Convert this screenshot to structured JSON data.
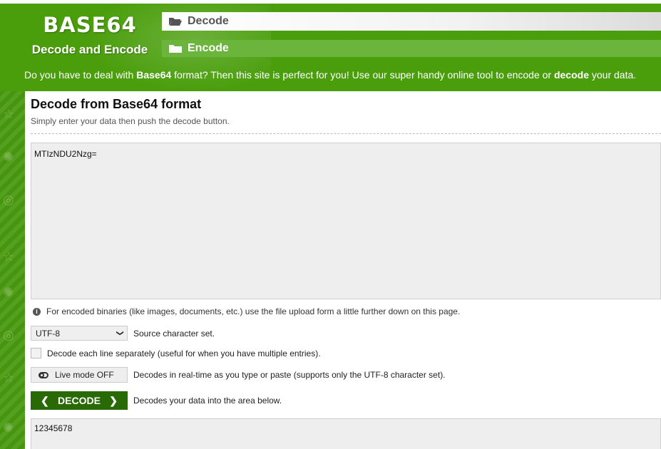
{
  "header": {
    "logo_title": "BASE64",
    "logo_subtitle": "Decode and Encode",
    "nav": [
      {
        "label": "Decode",
        "icon": "folder-open-icon"
      },
      {
        "label": "Encode",
        "icon": "folder-icon"
      }
    ],
    "intro_prefix": "Do you have to deal with ",
    "intro_bold1": "Base64",
    "intro_mid": " format? Then this site is perfect for you! Use our super handy online tool to encode or ",
    "intro_bold2": "decode",
    "intro_suffix": " your data."
  },
  "main": {
    "title": "Decode from Base64 format",
    "subtitle": "Simply enter your data then push the decode button.",
    "input_value": "MTIzNDU2Nzg=",
    "info_text": "For encoded binaries (like images, documents, etc.) use the file upload form a little further down on this page.",
    "charset": {
      "selected": "UTF-8",
      "label": "Source character set."
    },
    "each_line": {
      "label": "Decode each line separately (useful for when you have multiple entries).",
      "checked": false
    },
    "live_mode": {
      "button_label": "Live mode OFF",
      "description": "Decodes in real-time as you type or paste (supports only the UTF-8 character set)."
    },
    "decode_button": {
      "label": "DECODE",
      "description": "Decodes your data into the area below."
    },
    "output_value": "12345678"
  },
  "colors": {
    "brand_green": "#4a9e0c",
    "nav_encode": "#6cb53c",
    "decode_button": "#2a6a06"
  }
}
